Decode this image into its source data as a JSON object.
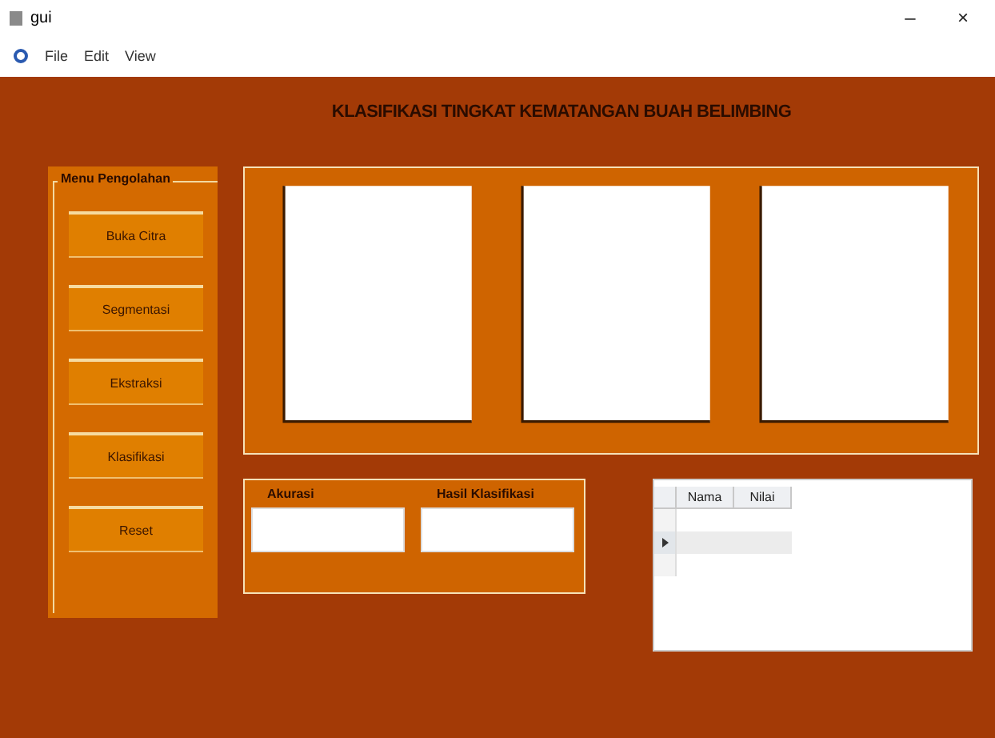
{
  "window": {
    "title": "gui",
    "controls": [
      "–",
      "×"
    ]
  },
  "toolbar": {
    "items": [
      "File",
      "Edit",
      "View"
    ]
  },
  "heading": "KLASIFIKASI TINGKAT KEMATANGAN BUAH BELIMBING",
  "menu_panel": {
    "title": "Menu Pengolahan",
    "buttons": [
      "Buka Citra",
      "Segmentasi",
      "Ekstraksi",
      "Klasifikasi",
      "Reset"
    ]
  },
  "plots": [
    {
      "kind": "plot"
    },
    {
      "kind": "plot"
    },
    {
      "kind": "plot"
    }
  ],
  "result_panel": {
    "fields": [
      {
        "label": "Akurasi"
      },
      {
        "label": "Hasil Klasifikasi"
      }
    ]
  },
  "table": {
    "columns": [
      "Nama",
      "Nilai"
    ],
    "rows": [
      {
        "selected": false
      },
      {
        "selected": true
      },
      {
        "selected": false
      }
    ]
  }
}
